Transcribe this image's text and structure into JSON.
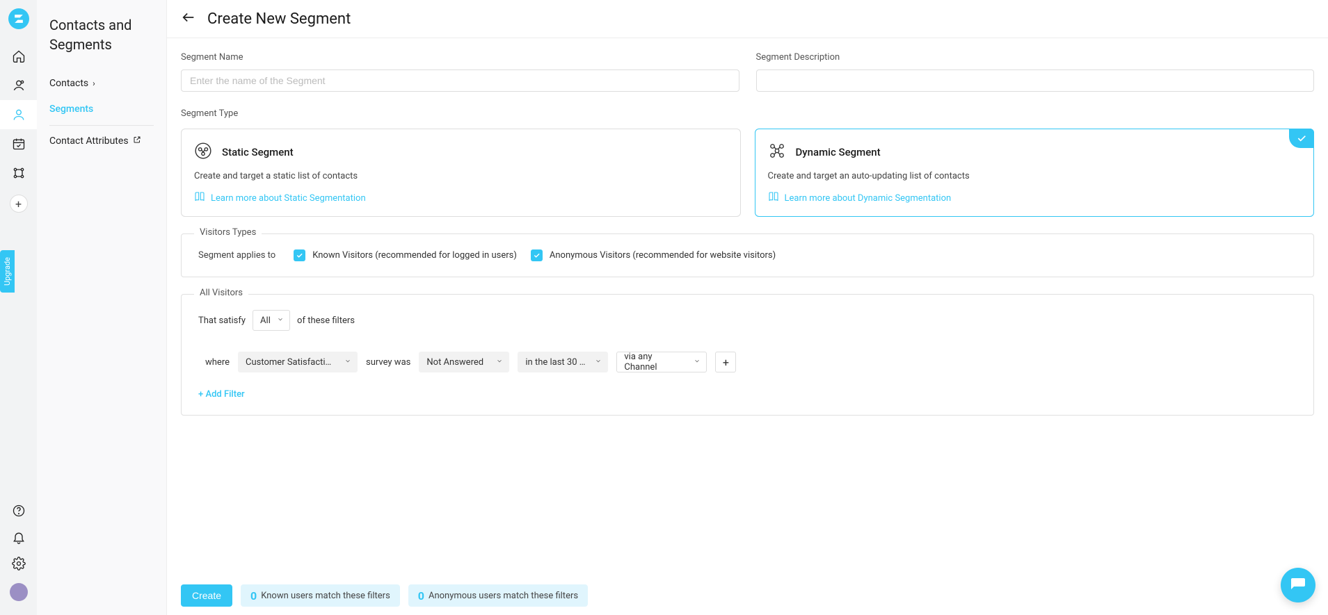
{
  "sidebar": {
    "title": "Contacts and Segments",
    "items": [
      {
        "label": "Contacts"
      },
      {
        "label": "Segments"
      },
      {
        "label": "Contact Attributes"
      }
    ],
    "upgrade": "Upgrade"
  },
  "page": {
    "title": "Create New Segment"
  },
  "form": {
    "name_label": "Segment Name",
    "name_placeholder": "Enter the name of the Segment",
    "desc_label": "Segment Description",
    "type_label": "Segment Type"
  },
  "types": {
    "static": {
      "title": "Static Segment",
      "desc": "Create and target a static list of contacts",
      "link": "Learn more about Static Segmentation"
    },
    "dynamic": {
      "title": "Dynamic Segment",
      "desc": "Create and target an auto-updating list of contacts",
      "link": "Learn more about Dynamic Segmentation"
    }
  },
  "visitors": {
    "legend": "Visitors Types",
    "applies_to": "Segment applies to",
    "known": "Known Visitors (recommended for logged in users)",
    "anonymous": "Anonymous Visitors (recommended for website visitors)"
  },
  "filters": {
    "legend": "All Visitors",
    "satisfy_pre": "That satisfy",
    "satisfy_sel": "All",
    "satisfy_post": "of these filters",
    "where": "where",
    "metric": "Customer Satisfactio…",
    "survey_was": "survey was",
    "answered": "Not Answered",
    "period": "in the last 30 …",
    "channel": "via any Channel",
    "add_filter": "+ Add Filter"
  },
  "footer": {
    "create": "Create",
    "known_count": "0",
    "known_text": "Known users match these filters",
    "anon_count": "0",
    "anon_text": "Anonymous users match these filters"
  }
}
